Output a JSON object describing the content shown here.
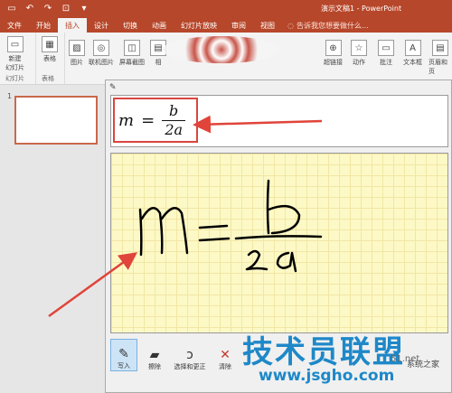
{
  "title_bar": {
    "doc_title": "演示文稿1 - PowerPoint",
    "undo_icon": "undo-icon",
    "redo_icon": "redo-icon"
  },
  "ribbon_tabs": [
    "文件",
    "开始",
    "插入",
    "设计",
    "切换",
    "动画",
    "幻灯片放映",
    "审阅",
    "视图"
  ],
  "active_tab": "插入",
  "tell_me": "告诉我您想要做什么...",
  "ribbon": {
    "new_slide": "新建幻灯片",
    "new_slide_line1": "新建",
    "new_slide_line2": "幻灯片",
    "table": "表格",
    "images": "图片",
    "online_images": "联机图片",
    "screenshot": "屏幕截图",
    "album": "相",
    "hyperlink": "超链接",
    "action": "动作",
    "comment": "批注",
    "textbox": "文本框",
    "header_footer": "页眉和页",
    "group_slides": "幻灯片",
    "group_tables": "表格"
  },
  "slide_panel": {
    "slide_number": "1"
  },
  "math_input": {
    "formula_var": "m",
    "formula_eq": "=",
    "formula_num": "b",
    "formula_den": "2a",
    "tools": [
      "写入",
      "擦除",
      "选择和更正",
      "清除"
    ]
  },
  "watermark": {
    "text": "技术员联盟",
    "url": "www.jsgho.com",
    "side_number": "51.net",
    "site": "系统之家"
  }
}
